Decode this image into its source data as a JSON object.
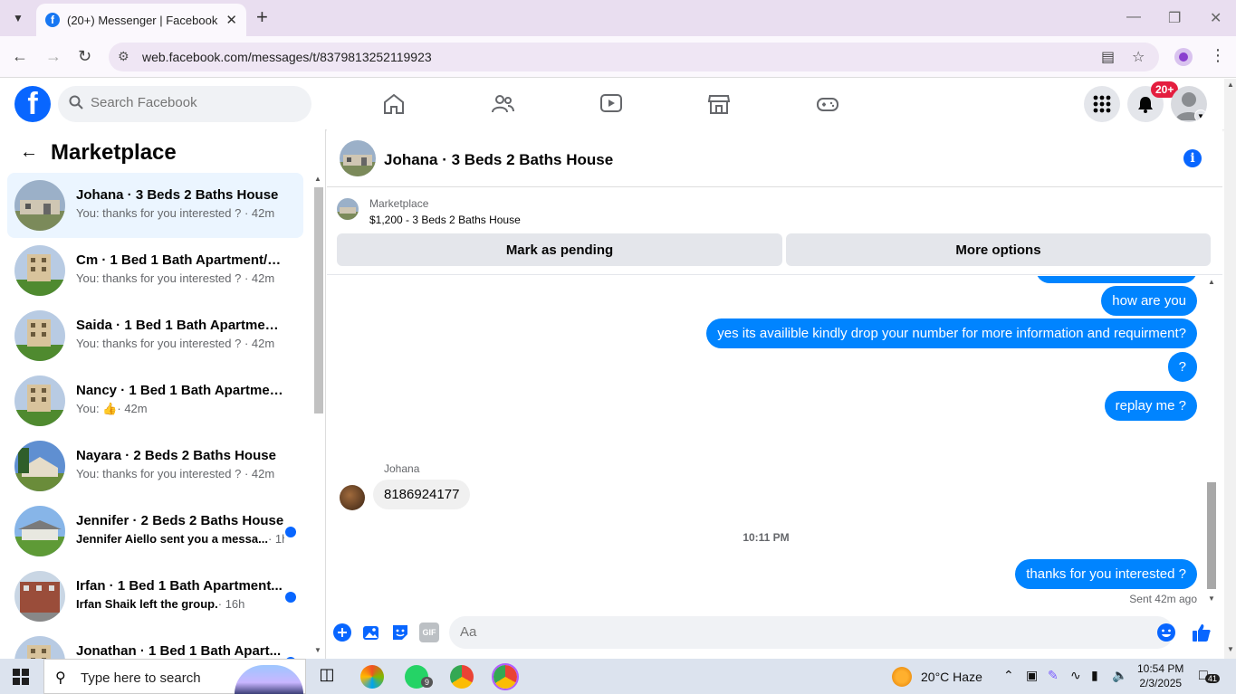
{
  "browser": {
    "tab_title": "(20+) Messenger | Facebook",
    "url": "web.facebook.com/messages/t/8379813252119923"
  },
  "fb_header": {
    "search_placeholder": "Search Facebook",
    "notification_badge": "20+"
  },
  "sidebar": {
    "title": "Marketplace",
    "conversations": [
      {
        "name": "Johana · 3 Beds 2 Baths House",
        "snippet": "You: thanks for you interested ? · 42m",
        "active": true,
        "unread": false,
        "thumb": "house"
      },
      {
        "name": "Cm · 1 Bed 1 Bath Apartment/co...",
        "snippet": "You: thanks for you interested ? · 42m",
        "active": false,
        "unread": false,
        "thumb": "apt"
      },
      {
        "name": "Saida · 1 Bed 1 Bath Apartment/...",
        "snippet": "You: thanks for you interested ? · 42m",
        "active": false,
        "unread": false,
        "thumb": "apt"
      },
      {
        "name": "Nancy · 1 Bed 1 Bath Apartment...",
        "snippet_prefix": "You:",
        "snippet_suffix": "· 42m",
        "active": false,
        "unread": false,
        "thumb": "apt"
      },
      {
        "name": "Nayara · 2 Beds 2 Baths House",
        "snippet": "You: thanks for you interested ? · 42m",
        "active": false,
        "unread": false,
        "thumb": "house2"
      },
      {
        "name": "Jennifer · 2 Beds 2 Baths House",
        "snippet_bold": "Jennifer Aiello sent you a messa...",
        "snippet_time": "· 1h",
        "active": false,
        "unread": true,
        "thumb": "house3"
      },
      {
        "name": "Irfan · 1 Bed 1 Bath Apartment...",
        "snippet_bold": "Irfan Shaik left the group.",
        "snippet_time": "· 16h",
        "active": false,
        "unread": true,
        "thumb": "brick"
      },
      {
        "name": "Jonathan · 1 Bed 1 Bath Apart...",
        "snippet": "",
        "active": false,
        "unread": true,
        "thumb": "apt"
      }
    ]
  },
  "chat": {
    "title": "Johana · 3 Beds 2 Baths House",
    "marketplace_label": "Marketplace",
    "listing": "$1,200 - 3 Beds 2 Baths House",
    "btn_pending": "Mark as pending",
    "btn_more": "More options",
    "messages": {
      "out1": "how are you",
      "out2": "yes its availible kindly drop your number for more information and requirment?",
      "out3": "?",
      "out4": "replay me ?",
      "in_sender": "Johana",
      "in1": "8186924177",
      "timestamp": "10:11 PM",
      "out5": "thanks for you interested ?",
      "sent_status": "Sent 42m ago"
    },
    "composer_placeholder": "Aa",
    "gif_label": "GIF"
  },
  "taskbar": {
    "search_text": "Type here to search",
    "weather": "20°C  Haze",
    "time": "10:54 PM",
    "date": "2/3/2025",
    "whatsapp_badge": "9",
    "notif_count": "41"
  },
  "colors": {
    "fb_blue": "#0866ff",
    "messenger_blue": "#0084ff",
    "unread_dot": "#0866ff"
  }
}
